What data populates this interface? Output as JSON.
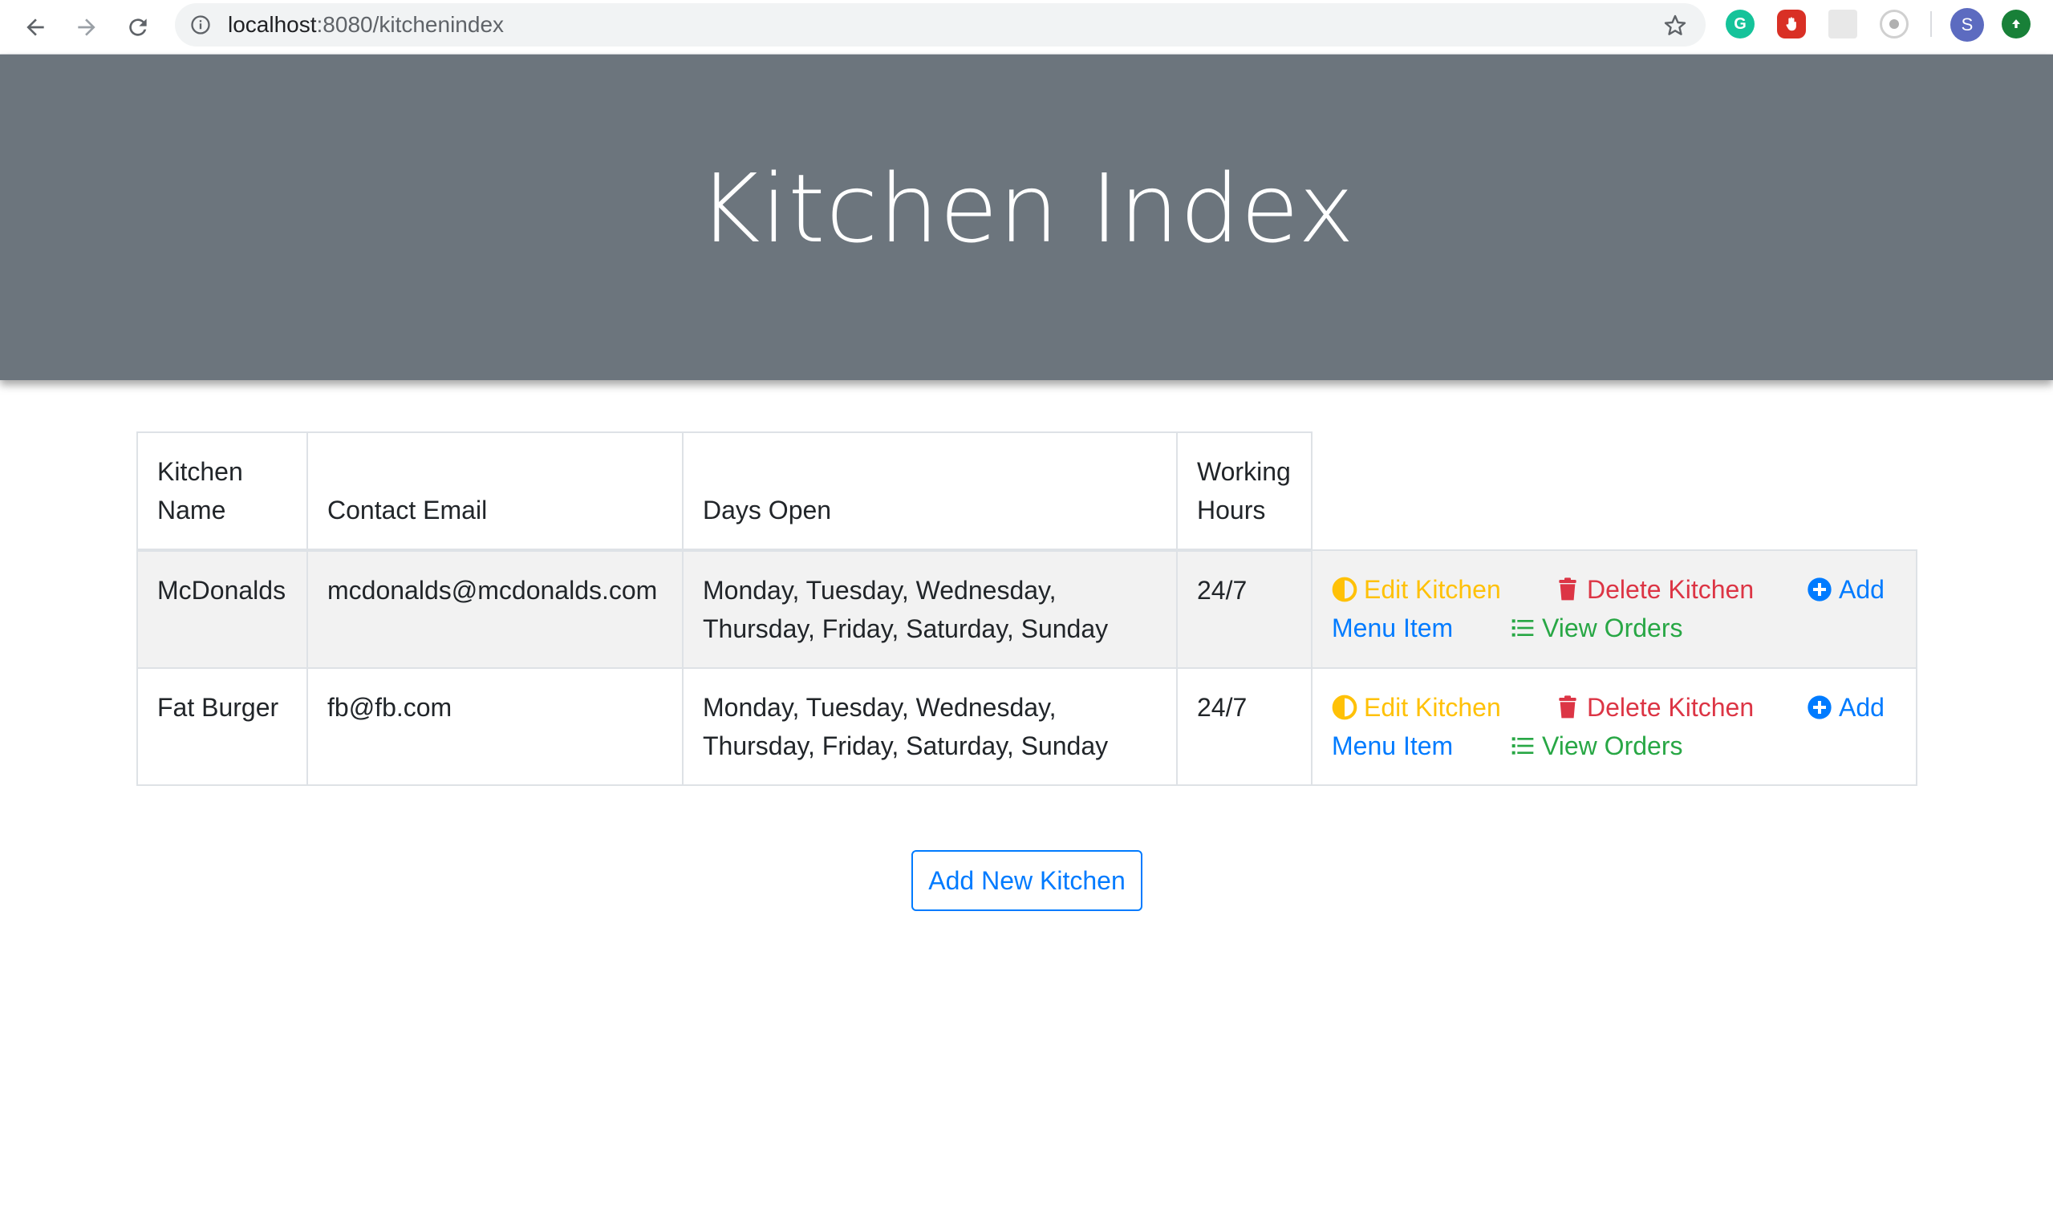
{
  "browser": {
    "url_host": "localhost",
    "url_path": ":8080/kitchenindex",
    "avatar_letter": "S",
    "extension_g_letter": "G"
  },
  "hero": {
    "title": "Kitchen Index",
    "background_color": "#6c757d"
  },
  "table": {
    "headers": {
      "name": "Kitchen Name",
      "email": "Contact Email",
      "days": "Days Open",
      "hours": "Working Hours"
    },
    "rows": [
      {
        "name": "McDonalds",
        "email": "mcdonalds@mcdonalds.com",
        "days": "Monday, Tuesday, Wednesday, Thursday, Friday, Saturday, Sunday",
        "hours": "24/7"
      },
      {
        "name": "Fat Burger",
        "email": "fb@fb.com",
        "days": "Monday, Tuesday, Wednesday, Thursday, Friday, Saturday, Sunday",
        "hours": "24/7"
      }
    ],
    "actions": {
      "edit_label": "Edit Kitchen",
      "delete_label": "Delete Kitchen",
      "add_label": "Add",
      "menu_item_label": "Menu Item",
      "view_orders_label": "View Orders"
    }
  },
  "add_button_label": "Add New Kitchen",
  "colors": {
    "warning": "#ffc107",
    "danger": "#dc3545",
    "primary": "#007bff",
    "success": "#28a745"
  }
}
